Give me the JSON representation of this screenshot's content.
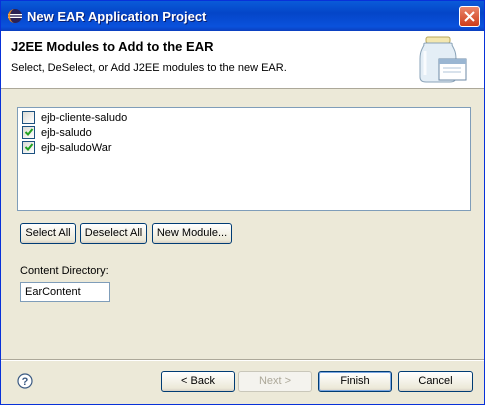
{
  "window": {
    "title": "New EAR Application Project",
    "app_icon": "eclipse-icon",
    "close_icon": "close-icon"
  },
  "header": {
    "title": "J2EE Modules to Add to the EAR",
    "description": "Select, DeSelect, or Add J2EE modules to the new EAR.",
    "banner_icon": "jar-icon"
  },
  "modules": [
    {
      "label": "ejb-cliente-saludo",
      "checked": false
    },
    {
      "label": "ejb-saludo",
      "checked": true
    },
    {
      "label": "ejb-saludoWar",
      "checked": true
    }
  ],
  "actions": {
    "select_all": "Select All",
    "deselect_all": "Deselect All",
    "new_module": "New Module..."
  },
  "content_directory": {
    "label": "Content Directory:",
    "value": "EarContent"
  },
  "footer": {
    "help_icon": "help-icon",
    "back": "< Back",
    "next": "Next >",
    "finish": "Finish",
    "cancel": "Cancel",
    "next_enabled": false
  }
}
